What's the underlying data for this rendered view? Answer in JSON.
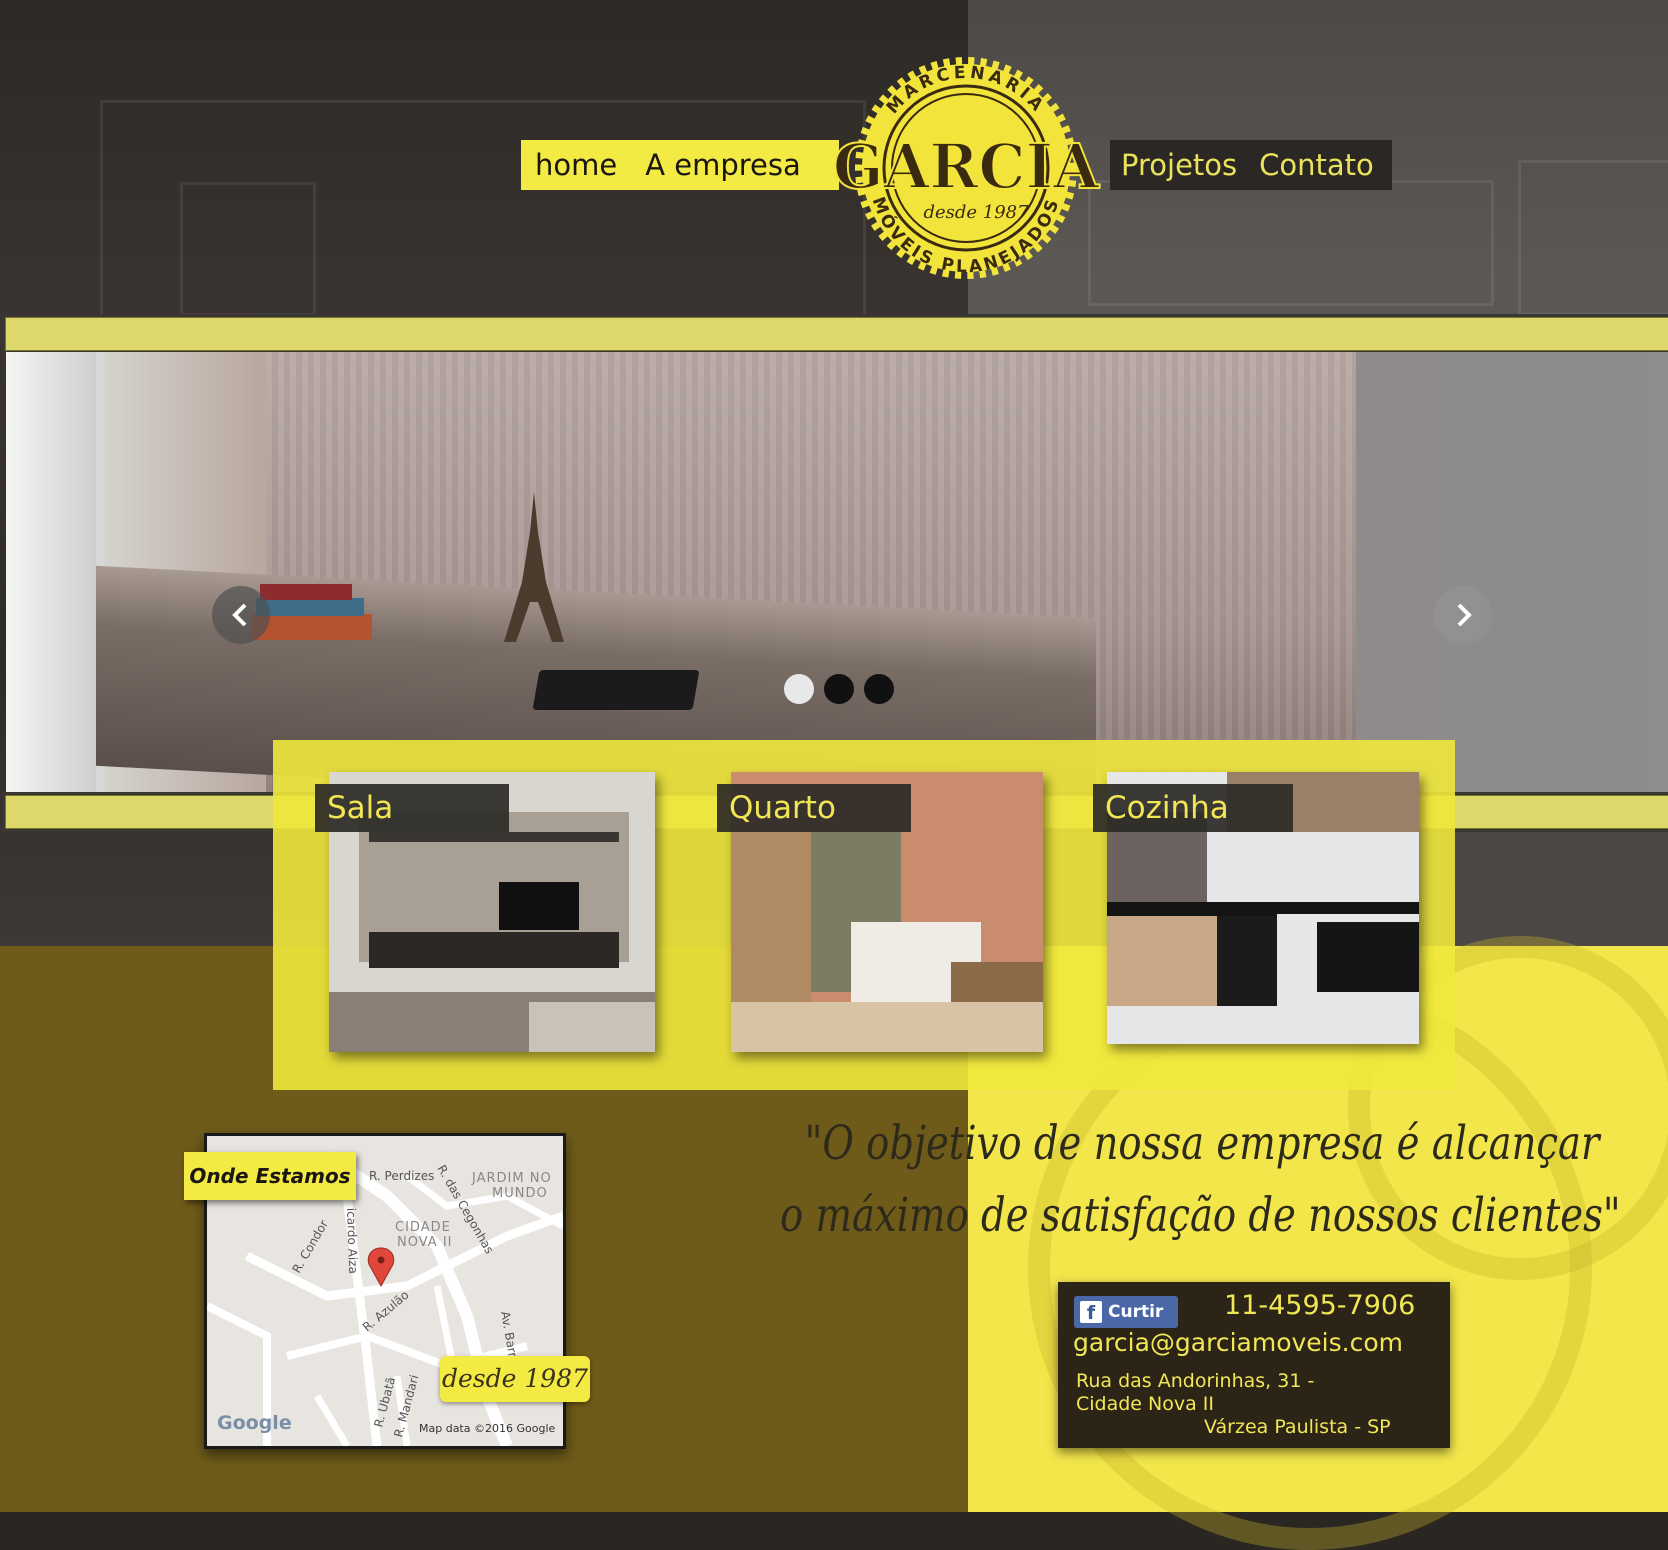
{
  "nav": {
    "home": "home",
    "company": "A empresa",
    "projects": "Projetos",
    "contact": "Contato"
  },
  "logo": {
    "top_text": "MARCENARIA",
    "name": "GARCIA",
    "since": "desde 1987",
    "bottom_text": "MÓVEIS PLANEJADOS"
  },
  "carousel": {
    "slide_count": 3,
    "active_index": 0
  },
  "categories": [
    {
      "label": "Sala"
    },
    {
      "label": "Quarto"
    },
    {
      "label": "Cozinha"
    }
  ],
  "map": {
    "tag": "Onde Estamos",
    "since_tag": "desde 1987",
    "labels": {
      "perdizes": "R. Perdizes",
      "cegonhas": "R. das Cegonhas",
      "jardim": "JARDIM NO",
      "mundo": "MUNDO",
      "cidade": "CIDADE",
      "nova": "NOVA II",
      "condor": "R. Condor",
      "aiza": "icardo Aiza",
      "azulao": "R. Azulão",
      "barreto": "Av. Barreto",
      "ubata": "R. Ubatã",
      "mandari": "R. Mandari"
    },
    "google": "Google",
    "attribution": "Map data ©2016 Google"
  },
  "quote": {
    "line1": "\"O objetivo de nossa empresa é alcançar",
    "line2": "o máximo de satisfação de nossos clientes\""
  },
  "contact": {
    "facebook_label": "Curtir",
    "phone": "11-4595-7906",
    "email": "garcia@garciamoveis.com",
    "address_line1": "Rua das Andorinhas, 31 -",
    "address_line2": "Cidade Nova II",
    "address_line3": "Várzea Paulista - SP"
  },
  "colors": {
    "accent_yellow": "#f3ea43",
    "dark_brown": "#2c2416",
    "olive": "#6f5b19",
    "facebook_blue": "#4a68a8"
  }
}
